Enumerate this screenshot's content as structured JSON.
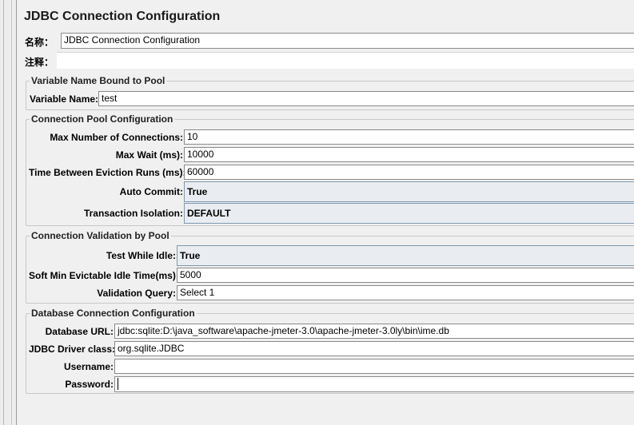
{
  "header": {
    "title": "JDBC Connection Configuration"
  },
  "name_row": {
    "label": "名称：",
    "value": "JDBC Connection Configuration"
  },
  "comment_row": {
    "label": "注释：",
    "value": ""
  },
  "variable_group": {
    "legend": "Variable Name Bound to Pool",
    "variable_name": {
      "label": "Variable Name:",
      "value": "test"
    }
  },
  "pool_group": {
    "legend": "Connection Pool Configuration",
    "max_connections": {
      "label": "Max Number of Connections:",
      "value": "10"
    },
    "max_wait": {
      "label": "Max Wait (ms):",
      "value": "10000"
    },
    "eviction": {
      "label": "Time Between Eviction Runs (ms):",
      "value": "60000"
    },
    "auto_commit": {
      "label": "Auto Commit:",
      "value": "True"
    },
    "transaction_isolation": {
      "label": "Transaction Isolation:",
      "value": "DEFAULT"
    }
  },
  "validation_group": {
    "legend": "Connection Validation by Pool",
    "test_while_idle": {
      "label": "Test While Idle:",
      "value": "True"
    },
    "soft_min_evictable": {
      "label": "Soft Min Evictable Idle Time(ms):",
      "value": "5000"
    },
    "validation_query": {
      "label": "Validation Query:",
      "value": "Select 1"
    }
  },
  "db_group": {
    "legend": "Database Connection Configuration",
    "database_url": {
      "label": "Database URL:",
      "value": "jdbc:sqlite:D:\\java_software\\apache-jmeter-3.0\\apache-jmeter-3.0ly\\bin\\ime.db"
    },
    "driver_class": {
      "label": "JDBC Driver class:",
      "value": "org.sqlite.JDBC"
    },
    "username": {
      "label": "Username:",
      "value": ""
    },
    "password": {
      "label": "Password:",
      "value": ""
    }
  }
}
